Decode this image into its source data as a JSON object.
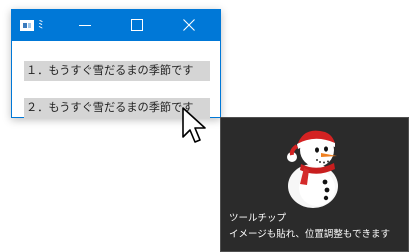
{
  "window": {
    "title": "ﾐ",
    "controls": {
      "minimize": "minimize-icon",
      "maximize": "maximize-icon",
      "close": "close-icon"
    },
    "accent_color": "#0078d7"
  },
  "list": {
    "items": [
      {
        "label": "１．もうすぐ雪だるまの季節です"
      },
      {
        "label": "２．もうすぐ雪だるまの季節です"
      }
    ]
  },
  "tooltip": {
    "title": "ツールチップ",
    "body": "イメージも貼れ、位置調整もできます",
    "image": "snowman-image",
    "background_color": "#2b2b2b"
  },
  "cursor": "arrow-cursor-icon"
}
